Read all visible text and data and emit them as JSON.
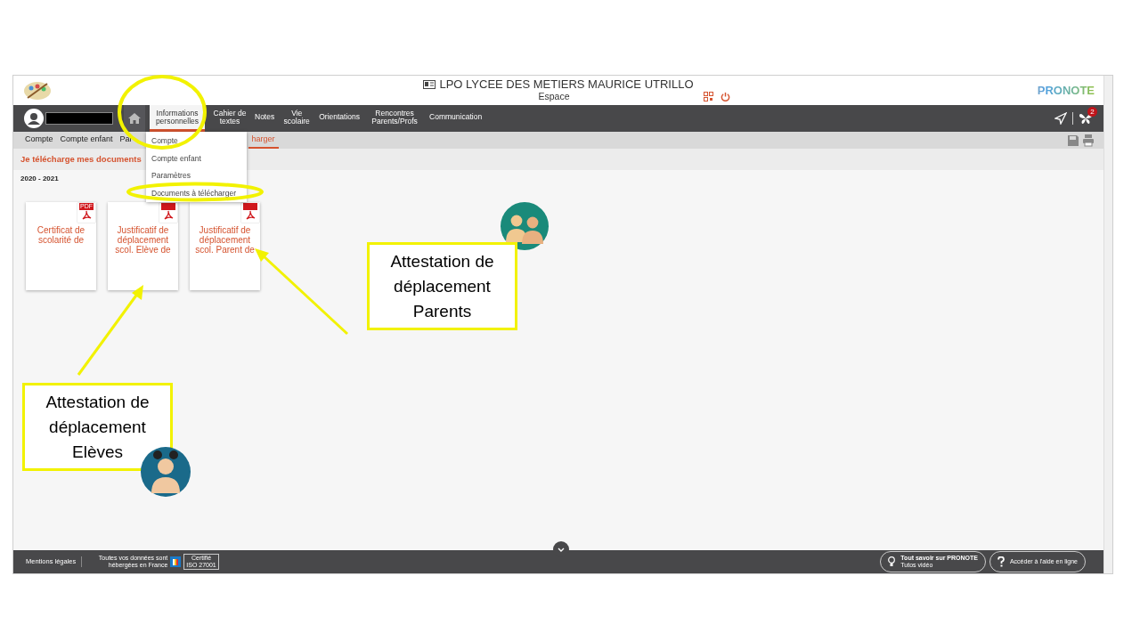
{
  "header": {
    "school": "LPO LYCEE DES METIERS MAURICE UTRILLO",
    "space": "Espace",
    "brand": "PRONOTE"
  },
  "nav": {
    "items": [
      {
        "label": "Informations personnelles",
        "selected": true
      },
      {
        "label": "Cahier de textes",
        "selected": false
      },
      {
        "label": "Notes",
        "selected": false
      },
      {
        "label": "Vie scolaire",
        "selected": false
      },
      {
        "label": "Orientations",
        "selected": false
      },
      {
        "label": "Rencontres Parents/Profs",
        "selected": false
      },
      {
        "label": "Communication",
        "selected": false
      }
    ],
    "notification_count": "2"
  },
  "subnav": [
    {
      "label": "Compte",
      "selected": false
    },
    {
      "label": "Compte enfant",
      "selected": false
    },
    {
      "label": "Par",
      "selected": false
    },
    {
      "label": "harger",
      "selected": true
    }
  ],
  "dropdown": [
    "Compte",
    "Compte enfant",
    "Paramètres",
    "Documents à télécharger"
  ],
  "page_title": "Je télécharge mes documents",
  "year": "2020 - 2021",
  "documents": [
    {
      "title": "Certificat de scolarité de",
      "badge": "PDF"
    },
    {
      "title": "Justificatif de déplacement scol. Elève de"
    },
    {
      "title": "Justificatif de déplacement scol. Parent de"
    }
  ],
  "footer": {
    "legal": "Mentions légales",
    "hosting": "Toutes vos données sont hébergées en France",
    "cert": [
      "Certifié",
      "ISO 27001"
    ],
    "buttons": [
      {
        "title": "Tout savoir sur PRONOTE",
        "subtitle": "Tutos vidéo"
      },
      {
        "title": "Accéder à l'aide en ligne"
      }
    ]
  },
  "callouts": [
    {
      "text": "Attestation de déplacement Parents"
    },
    {
      "text": "Attestation de déplacement Elèves"
    }
  ]
}
